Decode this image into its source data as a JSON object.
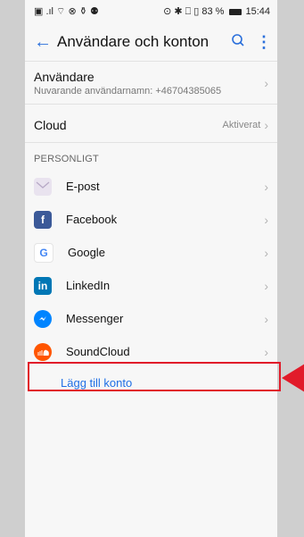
{
  "status_bar": {
    "left": "▣ .ıl ⌔ ⊗ ⚱ ⚉",
    "right": "⊙ ✱ ⎕ ▯ 83 %",
    "time": "15:44"
  },
  "app_bar": {
    "title": "Användare och konton",
    "back_icon": "back-arrow-icon",
    "search_icon": "search-icon",
    "menu_icon": "more-vert-icon"
  },
  "user": {
    "title": "Användare",
    "subtitle": "Nuvarande användarnamn: +46704385065"
  },
  "cloud": {
    "label": "Cloud",
    "status": "Aktiverat"
  },
  "section": {
    "title": "PERSONLIGT"
  },
  "accounts": [
    {
      "label": "E-post",
      "icon": "email-icon"
    },
    {
      "label": "Facebook",
      "icon": "facebook-icon"
    },
    {
      "label": "Google",
      "icon": "google-icon"
    },
    {
      "label": "LinkedIn",
      "icon": "linkedin-icon"
    },
    {
      "label": "Messenger",
      "icon": "messenger-icon"
    },
    {
      "label": "SoundCloud",
      "icon": "soundcloud-icon"
    }
  ],
  "add_account": {
    "label": "Lägg till konto"
  },
  "colors": {
    "accent": "#2a6fdb",
    "highlight": "#e11b2a"
  }
}
